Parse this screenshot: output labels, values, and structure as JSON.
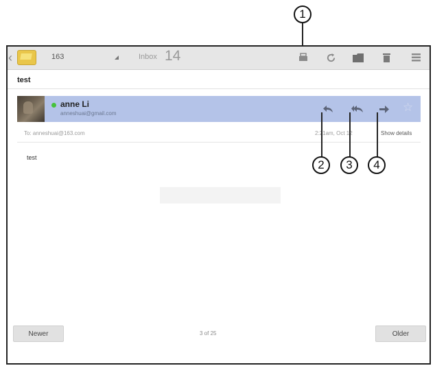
{
  "action_bar": {
    "back_icon": "chevron-left-icon",
    "app_icon": "email-app-icon",
    "account": "163",
    "folder_name": "Inbox",
    "folder_count": "14",
    "buttons": [
      "compose-icon",
      "refresh-icon",
      "folder-icon",
      "delete-icon",
      "menu-icon"
    ]
  },
  "message": {
    "subject": "test",
    "sender_name": "anne Li",
    "sender_email": "anneshuai@gmail.com",
    "to_line": "To: anneshuai@163.com",
    "date": "2:21am, Oct 12",
    "show_details": "Show details",
    "body": "test",
    "reply_icon": "reply-icon",
    "reply_all_icon": "reply-all-icon",
    "forward_icon": "forward-icon",
    "star_icon": "star-icon"
  },
  "footer": {
    "newer_label": "Newer",
    "older_label": "Older",
    "pager": "3 of 25"
  },
  "callouts": [
    "1",
    "2",
    "3",
    "4"
  ],
  "colors": {
    "sender_highlight": "#b4c3e8",
    "presence_online": "#46c23c",
    "action_bar_bg": "#e6e6e6"
  }
}
